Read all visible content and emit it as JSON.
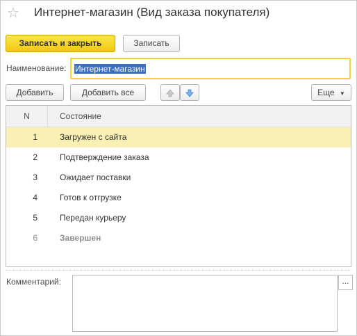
{
  "window": {
    "title": "Интернет-магазин (Вид заказа покупателя)",
    "favorite_icon": "star-icon"
  },
  "toolbar": {
    "save_close_label": "Записать и закрыть",
    "save_label": "Записать"
  },
  "form": {
    "name_label": "Наименование:",
    "name_value": "Интернет-магазин"
  },
  "table_toolbar": {
    "add_label": "Добавить",
    "add_all_label": "Добавить все",
    "move_up_icon": "arrow-up-icon",
    "move_down_icon": "arrow-down-icon",
    "more_label": "Еще",
    "more_icon": "caret-down-icon"
  },
  "table": {
    "columns": [
      "N",
      "Состояние"
    ],
    "rows": [
      {
        "n": "1",
        "state": "Загружен с сайта"
      },
      {
        "n": "2",
        "state": "Подтверждение заказа"
      },
      {
        "n": "3",
        "state": "Ожидает поставки"
      },
      {
        "n": "4",
        "state": "Готов к отгрузке"
      },
      {
        "n": "5",
        "state": "Передан курьеру"
      },
      {
        "n": "6",
        "state": "Завершен"
      }
    ]
  },
  "comment": {
    "label": "Комментарий:",
    "value": "",
    "select_button": "..."
  }
}
